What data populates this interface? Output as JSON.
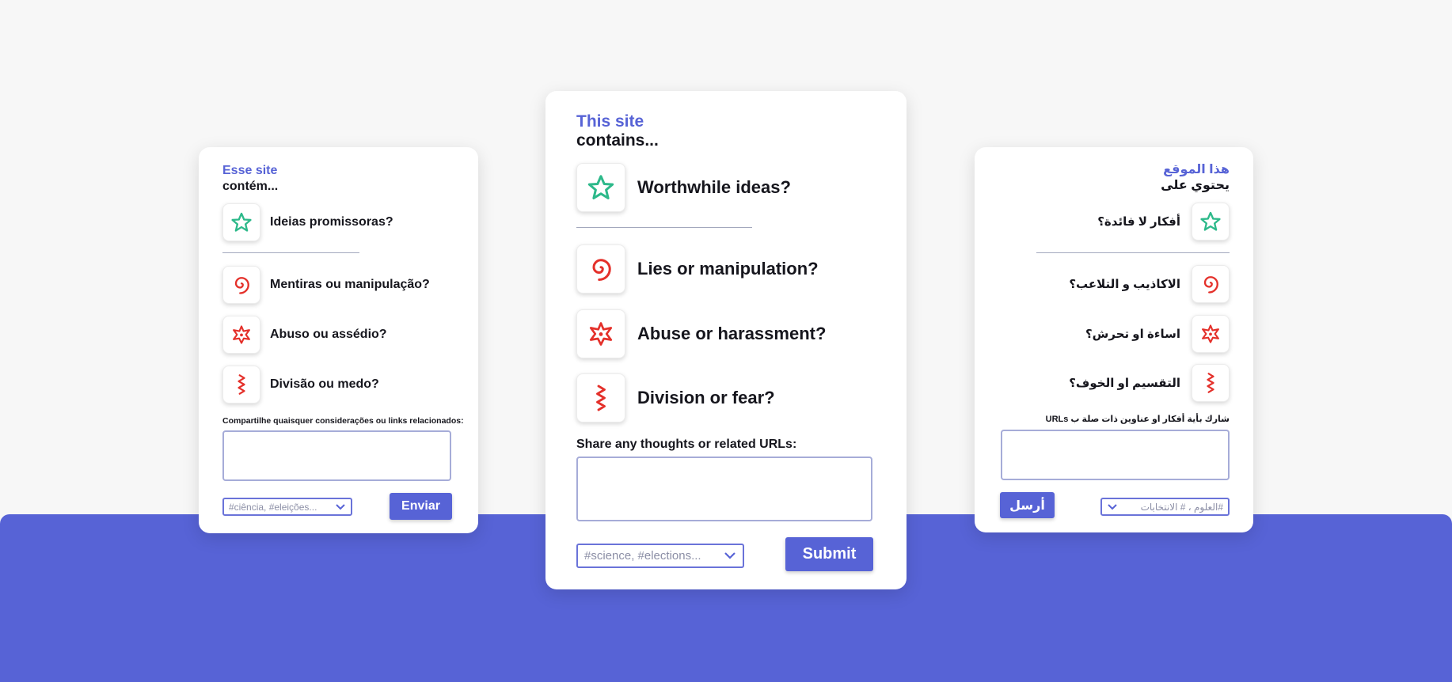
{
  "colors": {
    "accent": "#5763d6",
    "positive_icon": "#2db98a",
    "negative_icon": "#e4302a",
    "background": "#f7f7f7",
    "band": "#5763d6"
  },
  "cards": {
    "left": {
      "title_accent": "Esse site",
      "title_main": "contém...",
      "items": [
        {
          "icon": "star-icon",
          "label": "Ideias promissoras?"
        },
        {
          "icon": "spiral-icon",
          "label": "Mentiras ou manipulação?"
        },
        {
          "icon": "burst-star-icon",
          "label": "Abuso ou assédio?"
        },
        {
          "icon": "zigzag-icon",
          "label": "Divisão ou medo?"
        }
      ],
      "prompt": "Compartilhe quaisquer considerações ou links relacionados:",
      "tags_placeholder": "#ciência, #eleições...",
      "submit_label": "Enviar"
    },
    "center": {
      "title_accent": "This site",
      "title_main": "contains...",
      "items": [
        {
          "icon": "star-icon",
          "label": "Worthwhile ideas?"
        },
        {
          "icon": "spiral-icon",
          "label": "Lies or manipulation?"
        },
        {
          "icon": "burst-star-icon",
          "label": "Abuse or harassment?"
        },
        {
          "icon": "zigzag-icon",
          "label": "Division or fear?"
        }
      ],
      "prompt": "Share any thoughts or related URLs:",
      "tags_placeholder": "#science, #elections...",
      "submit_label": "Submit"
    },
    "right": {
      "title_accent": "هذا الموقع",
      "title_main": "يحتوي على",
      "items": [
        {
          "icon": "star-icon",
          "label": "أفكار لا فائدة؟"
        },
        {
          "icon": "spiral-icon",
          "label": "الاكاذيب و التلاعب؟"
        },
        {
          "icon": "burst-star-icon",
          "label": "اساءة او تحرش؟"
        },
        {
          "icon": "zigzag-icon",
          "label": "التقسيم او الخوف؟"
        }
      ],
      "prompt": "شارك بأية أفكار او عناوين ذات صلة ب URLs",
      "tags_placeholder": "#العلوم ، # الانتخابات",
      "submit_label": "أرسل"
    }
  }
}
